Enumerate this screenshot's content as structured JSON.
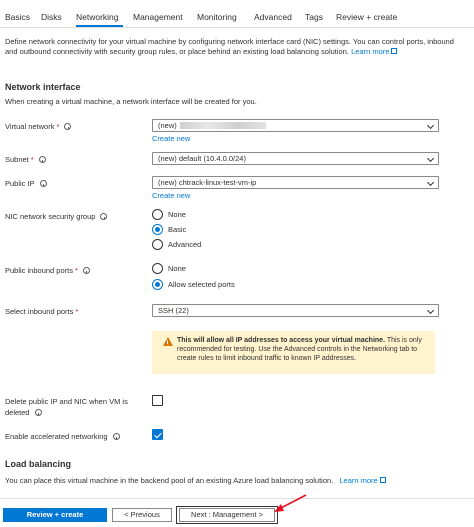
{
  "tabs": [
    {
      "label": "Basics",
      "active": false
    },
    {
      "label": "Disks",
      "active": false
    },
    {
      "label": "Networking",
      "active": true
    },
    {
      "label": "Management",
      "active": false
    },
    {
      "label": "Monitoring",
      "active": false
    },
    {
      "label": "Advanced",
      "active": false
    },
    {
      "label": "Tags",
      "active": false
    },
    {
      "label": "Review + create",
      "active": false
    }
  ],
  "intro": {
    "text": "Define network connectivity for your virtual machine by configuring network interface card (NIC) settings. You can control ports, inbound and outbound connectivity with security group rules, or place behind an existing load balancing solution.",
    "learn_more": "Learn more"
  },
  "network_interface": {
    "title": "Network interface",
    "description": "When creating a virtual machine, a network interface will be created for you.",
    "virtual_network": {
      "label": "Virtual network",
      "value_prefix": "(new)",
      "create_new": "Create new"
    },
    "subnet": {
      "label": "Subnet",
      "value": "(new) default (10.4.0.0/24)"
    },
    "public_ip": {
      "label": "Public IP",
      "value": "(new) chtrack-linux-test-vm-ip",
      "create_new": "Create new"
    },
    "nsg": {
      "label": "NIC network security group",
      "options": [
        "None",
        "Basic",
        "Advanced"
      ],
      "selected": "Basic"
    },
    "inbound_ports": {
      "label": "Public inbound ports",
      "options": [
        "None",
        "Allow selected ports"
      ],
      "selected": "Allow selected ports"
    },
    "select_ports": {
      "label": "Select inbound ports",
      "value": "SSH (22)"
    },
    "warning": {
      "bold": "This will allow all IP addresses to access your virtual machine.",
      "text": " This is only recommended for testing.  Use the Advanced controls in the Networking tab to create rules to limit inbound traffic to known IP addresses."
    },
    "delete_on_vm": {
      "label_line1": "Delete public IP and NIC when VM is",
      "label_line2": "deleted",
      "checked": false
    },
    "accelerated": {
      "label": "Enable accelerated networking",
      "checked": true
    }
  },
  "load_balancing": {
    "title": "Load balancing",
    "description": "You can place this virtual machine in the backend pool of an existing Azure load balancing solution.",
    "learn_more": "Learn more"
  },
  "footer": {
    "review_create": "Review + create",
    "previous": "< Previous",
    "next": "Next : Management >"
  },
  "colors": {
    "accent": "#0078d4",
    "annotation_arrow": "#e81123",
    "warning_bg": "#fff4ce"
  }
}
